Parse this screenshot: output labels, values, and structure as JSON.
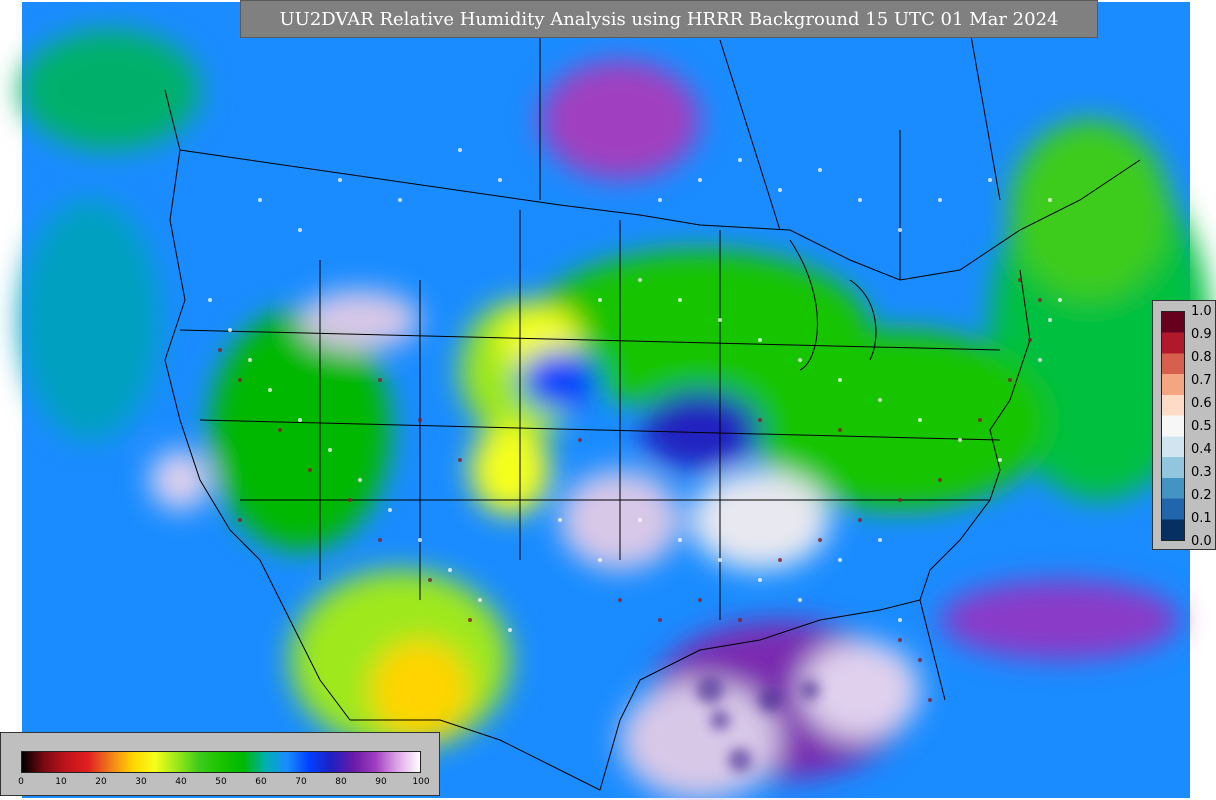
{
  "title": "UU2DVAR Relative Humidity Analysis using HRRR Background 15 UTC 01 Mar 2024",
  "colorbar": {
    "ticks": [
      "0",
      "10",
      "20",
      "30",
      "40",
      "50",
      "60",
      "70",
      "80",
      "90",
      "100"
    ],
    "colors": [
      "#000000",
      "#7a0a12",
      "#c0131b",
      "#e02020",
      "#f07e1a",
      "#ffd400",
      "#f5ff1a",
      "#9ee81a",
      "#3ccc1a",
      "#19c400",
      "#00b800",
      "#00b0b0",
      "#1a8cff",
      "#0040ff",
      "#2020c0",
      "#6a1aa8",
      "#a040c0",
      "#e0a8e8",
      "#ffffff"
    ]
  },
  "station_scale": {
    "labels": [
      "1.0",
      "0.9",
      "0.8",
      "0.7",
      "0.6",
      "0.5",
      "0.4",
      "0.3",
      "0.2",
      "0.1",
      "0.0"
    ],
    "colors": [
      "#67001f",
      "#b2182b",
      "#d6604d",
      "#f4a582",
      "#fddbc7",
      "#f7f7f7",
      "#d1e5f0",
      "#92c5de",
      "#4393c3",
      "#2166ac",
      "#053061"
    ]
  }
}
